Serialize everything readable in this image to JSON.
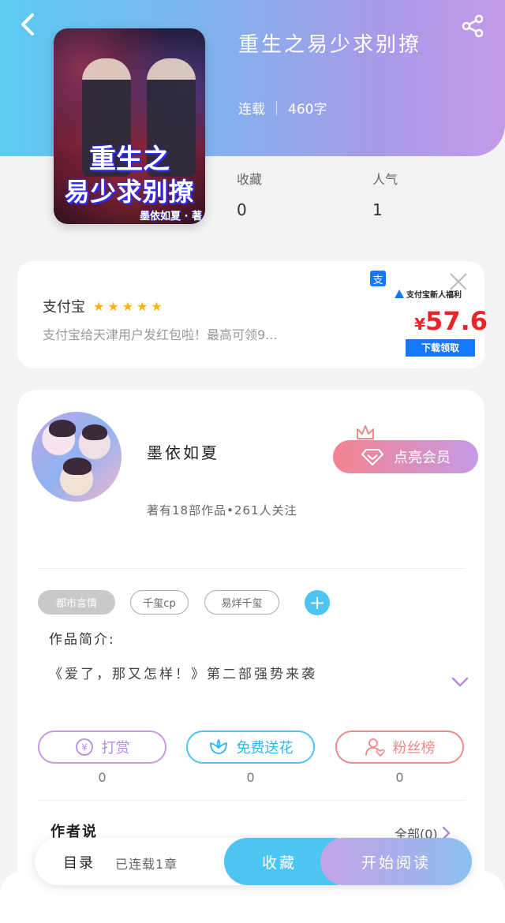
{
  "header": {
    "back_icon": "back-arrow-icon",
    "share_icon": "share-icon"
  },
  "book": {
    "title": "重生之易少求别撩",
    "status": "连载",
    "word_count": "460字",
    "cover": {
      "title_line1": "重生之",
      "title_line2": "易少求别撩",
      "author": "墨依如夏 · 著"
    },
    "stats": [
      {
        "label": "收藏",
        "value": "0"
      },
      {
        "label": "人气",
        "value": "1"
      }
    ]
  },
  "ad": {
    "app_name": "支付宝",
    "rating_stars": 5,
    "description": "支付宝给天津用户发红包啦！最高可领9...",
    "promo_head": "支付宝新人福利",
    "price_symbol": "¥",
    "price": "57.6",
    "download_label": "下载领取",
    "app_icon_glyph": "支",
    "close_icon": "close-icon"
  },
  "author": {
    "name": "墨依如夏",
    "stats": "著有18部作品•261人关注",
    "vip_label": "点亮会员"
  },
  "tags": [
    "都市言情",
    "千玺cp",
    "易烊千玺"
  ],
  "intro": {
    "label": "作品简介:",
    "text": "《爱了，那又怎样！》第二部强势来袭"
  },
  "actions": [
    {
      "label": "打赏",
      "count": "0",
      "icon": "yen-coin-icon",
      "color": "#b48be6"
    },
    {
      "label": "免费送花",
      "count": "0",
      "icon": "flower-icon",
      "color": "#30b5ea"
    },
    {
      "label": "粉丝榜",
      "count": "0",
      "icon": "fan-user-icon",
      "color": "#f08a8a"
    }
  ],
  "author_say": {
    "label": "作者说",
    "all_label": "全部(0)"
  },
  "bottom_bar": {
    "toc_label": "目录",
    "toc_sub": "已连载1章",
    "collect_label": "收藏",
    "read_label": "开始阅读"
  }
}
